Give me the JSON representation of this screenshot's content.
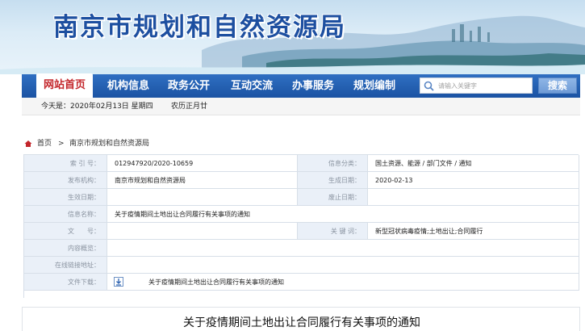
{
  "header": {
    "site_title": "南京市规划和自然资源局"
  },
  "nav": {
    "items": [
      {
        "label": "网站首页",
        "active": true
      },
      {
        "label": "机构信息",
        "active": false
      },
      {
        "label": "政务公开",
        "active": false
      },
      {
        "label": "互动交流",
        "active": false
      },
      {
        "label": "办事服务",
        "active": false
      },
      {
        "label": "规划编制",
        "active": false
      }
    ],
    "search": {
      "placeholder": "请输入关键字",
      "button_label": "搜索"
    }
  },
  "datebar": {
    "today_label": "今天是：2020年02月13日 星期四",
    "lunar": "农历正月廿"
  },
  "breadcrumb": {
    "home": "首页",
    "separator": ">",
    "current": "南京市规划和自然资源局"
  },
  "info": {
    "index_no_label": "索 引 号：",
    "index_no": "012947920/2020-10659",
    "category_label": "信息分类：",
    "category": "国土资源、能源 / 部门文件 / 通知",
    "issuer_label": "发布机构：",
    "issuer": "南京市规划和自然资源局",
    "created_label": "生成日期：",
    "created": "2020-02-13",
    "effective_label": "生效日期：",
    "effective": "",
    "expire_label": "废止日期：",
    "expire": "",
    "name_label": "信息名称：",
    "name": "关于疫情期间土地出让合同履行有关事项的通知",
    "doc_no_label": "文　　号：",
    "doc_no": "",
    "keywords_label": "关 键 词：",
    "keywords": "新型冠状病毒疫情;土地出让;合同履行",
    "summary_label": "内容概览：",
    "summary": "",
    "online_label": "在线链接地址：",
    "online": "",
    "download_label": "文件下载：",
    "download": "关于疫情期间土地出让合同履行有关事项的通知"
  },
  "article": {
    "title": "关于疫情期间土地出让合同履行有关事项的通知"
  },
  "colors": {
    "nav_blue": "#1b53a3",
    "active_red": "#c3262b",
    "title_blue": "#1d4fa0",
    "label_bg": "#eaf0f8"
  }
}
